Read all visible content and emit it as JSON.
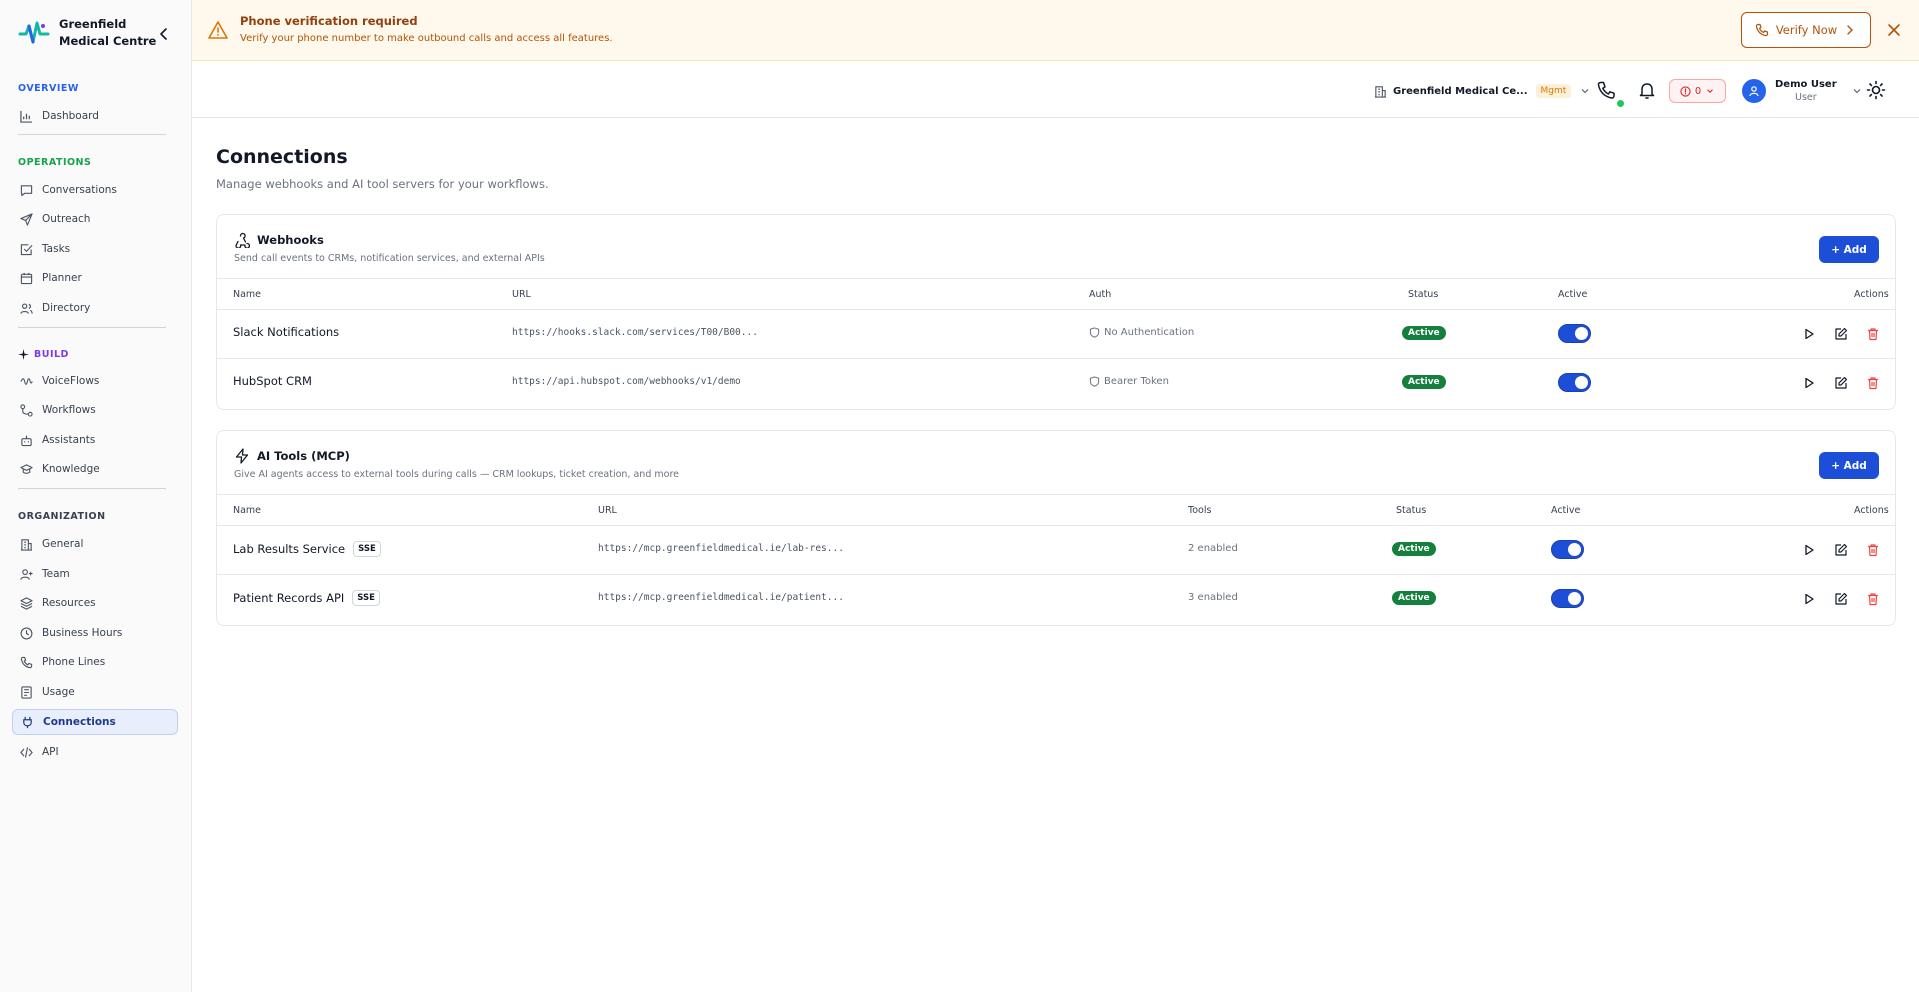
{
  "brand": {
    "name": "Greenfield Medical Centre"
  },
  "sidebar": {
    "sections": {
      "overview": "OVERVIEW",
      "operations": "OPERATIONS",
      "build": "BUILD",
      "organization": "ORGANIZATION"
    },
    "items": {
      "dashboard": "Dashboard",
      "conversations": "Conversations",
      "outreach": "Outreach",
      "tasks": "Tasks",
      "planner": "Planner",
      "directory": "Directory",
      "voiceflows": "VoiceFlows",
      "workflows": "Workflows",
      "assistants": "Assistants",
      "knowledge": "Knowledge",
      "general": "General",
      "team": "Team",
      "resources": "Resources",
      "business_hours": "Business Hours",
      "phone_lines": "Phone Lines",
      "usage": "Usage",
      "connections": "Connections",
      "api": "API"
    },
    "active": "connections",
    "colors": {
      "overview": "#2563eb",
      "operations": "#16a34a",
      "build": "#7c3aed",
      "organization": "#374151"
    }
  },
  "banner": {
    "title": "Phone verification required",
    "text": "Verify your phone number to make outbound calls and access all features.",
    "verify_label": "Verify Now"
  },
  "topbar": {
    "org_name": "Greenfield Medical Ce...",
    "org_badge": "Mgmt",
    "alert_count": "0",
    "user_name": "Demo User",
    "user_role": "User"
  },
  "page": {
    "title": "Connections",
    "subtitle": "Manage webhooks and AI tool servers for your workflows."
  },
  "webhooks": {
    "title": "Webhooks",
    "description": "Send call events to CRMs, notification services, and external APIs",
    "add_label": "+ Add",
    "columns": {
      "name": "Name",
      "url": "URL",
      "auth": "Auth",
      "status": "Status",
      "active": "Active",
      "actions": "Actions"
    },
    "rows": [
      {
        "name": "Slack Notifications",
        "url": "https://hooks.slack.com/services/T00/B00...",
        "auth": "No Authentication",
        "status": "Active",
        "active": true
      },
      {
        "name": "HubSpot CRM",
        "url": "https://api.hubspot.com/webhooks/v1/demo",
        "auth": "Bearer Token",
        "status": "Active",
        "active": true
      }
    ]
  },
  "mcp": {
    "title": "AI Tools (MCP)",
    "description": "Give AI agents access to external tools during calls — CRM lookups, ticket creation, and more",
    "add_label": "+ Add",
    "columns": {
      "name": "Name",
      "url": "URL",
      "tools": "Tools",
      "status": "Status",
      "active": "Active",
      "actions": "Actions"
    },
    "rows": [
      {
        "name": "Lab Results Service",
        "badge": "SSE",
        "url": "https://mcp.greenfieldmedical.ie/lab-res...",
        "tools": "2 enabled",
        "status": "Active",
        "active": true
      },
      {
        "name": "Patient Records API",
        "badge": "SSE",
        "url": "https://mcp.greenfieldmedical.ie/patient...",
        "tools": "3 enabled",
        "status": "Active",
        "active": true
      }
    ]
  }
}
